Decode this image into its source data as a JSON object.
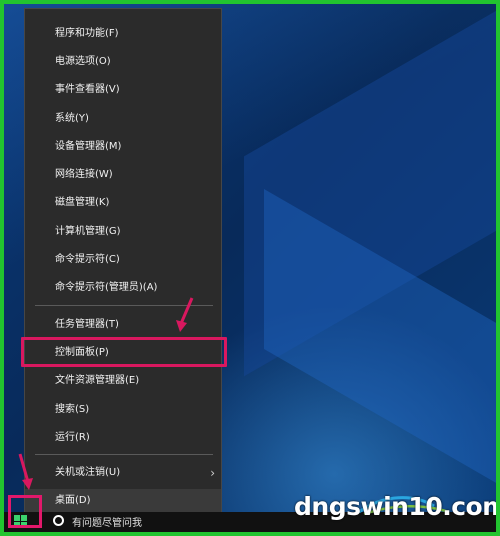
{
  "menu": {
    "items": [
      {
        "label": "程序和功能(F)"
      },
      {
        "label": "电源选项(O)"
      },
      {
        "label": "事件查看器(V)"
      },
      {
        "label": "系统(Y)"
      },
      {
        "label": "设备管理器(M)"
      },
      {
        "label": "网络连接(W)"
      },
      {
        "label": "磁盘管理(K)"
      },
      {
        "label": "计算机管理(G)"
      },
      {
        "label": "命令提示符(C)"
      },
      {
        "label": "命令提示符(管理员)(A)"
      },
      {
        "label": "任务管理器(T)"
      },
      {
        "label": "控制面板(P)"
      },
      {
        "label": "文件资源管理器(E)"
      },
      {
        "label": "搜索(S)"
      },
      {
        "label": "运行(R)"
      },
      {
        "label": "关机或注销(U)"
      },
      {
        "label": "桌面(D)"
      }
    ]
  },
  "taskbar": {
    "search_text": "有问题尽管问我"
  },
  "watermark": {
    "text": "dngswin10.com"
  },
  "colors": {
    "border_green": "#22c42f",
    "highlight_pink": "#d9185f",
    "menu_bg": "#2b2b2b"
  }
}
